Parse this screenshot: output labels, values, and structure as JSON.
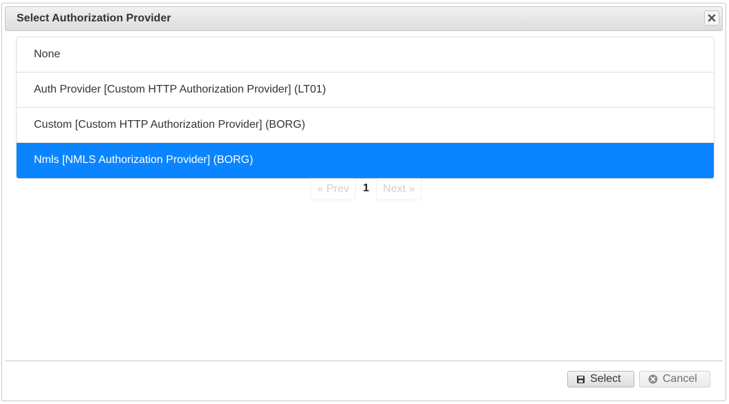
{
  "dialog": {
    "title": "Select Authorization Provider"
  },
  "providers": [
    {
      "label": "None",
      "selected": false
    },
    {
      "label": "Auth Provider [Custom HTTP Authorization Provider] (LT01)",
      "selected": false
    },
    {
      "label": "Custom [Custom HTTP Authorization Provider] (BORG)",
      "selected": false
    },
    {
      "label": "Nmls [NMLS Authorization Provider] (BORG)",
      "selected": true
    }
  ],
  "pagination": {
    "prev_label": "« Prev",
    "current_page": "1",
    "next_label": "Next »"
  },
  "buttons": {
    "select_label": "Select",
    "cancel_label": "Cancel"
  },
  "icons": {
    "close": "close-icon",
    "select": "save-icon",
    "cancel": "cancel-circle-icon"
  },
  "colors": {
    "selected_row": "#0a84ff"
  }
}
